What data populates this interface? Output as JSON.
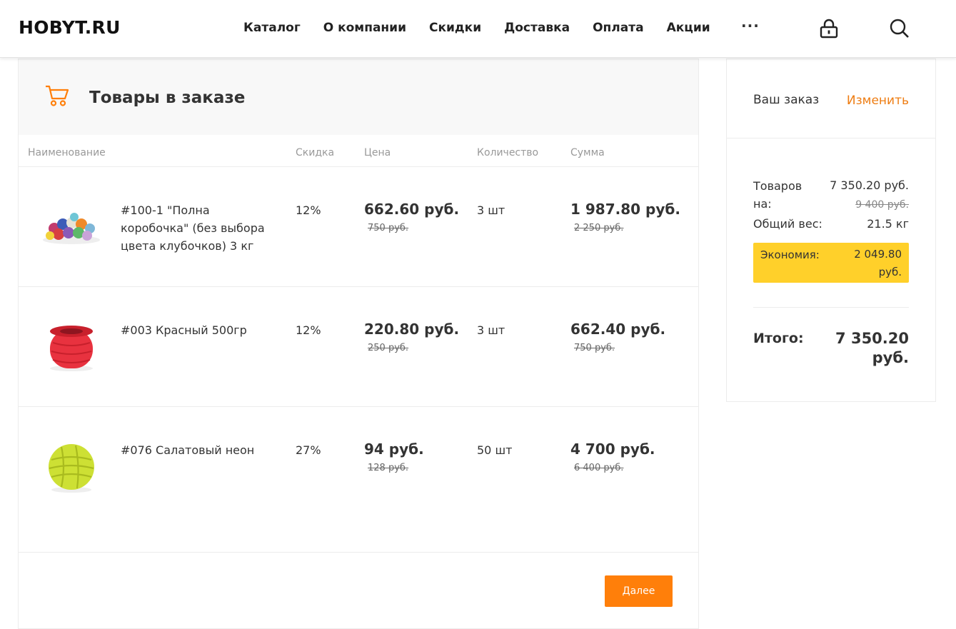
{
  "header": {
    "logo": "HOBYT.RU",
    "nav": [
      "Каталог",
      "О компании",
      "Скидки",
      "Доставка",
      "Оплата",
      "Акции"
    ],
    "more": "···",
    "lock_icon": "lock-icon",
    "search_icon": "search-icon"
  },
  "order": {
    "title": "Товары в заказе",
    "cart_icon": "cart-icon",
    "columns": {
      "name": "Наименование",
      "discount": "Скидка",
      "price": "Цена",
      "quantity": "Количество",
      "sum": "Сумма"
    },
    "items": [
      {
        "name": "#100-1 \"Полна коробочка\" (без выбора цвета клубочков) 3 кг",
        "discount": "12%",
        "price": "662.60 руб.",
        "old_price": "750 руб.",
        "quantity": "3 шт",
        "sum": "1 987.80 руб.",
        "old_sum": "2 250 руб.",
        "thumb": "multicolor-yarn-balls"
      },
      {
        "name": "#003 Красный 500гр",
        "discount": "12%",
        "price": "220.80 руб.",
        "old_price": "250 руб.",
        "quantity": "3 шт",
        "sum": "662.40 руб.",
        "old_sum": "750 руб.",
        "thumb": "red-yarn-spool",
        "thumb_color": "#e8323f"
      },
      {
        "name": "#076 Салатовый неон",
        "discount": "27%",
        "price": "94 руб.",
        "old_price": "128 руб.",
        "quantity": "50 шт",
        "sum": "4 700 руб.",
        "old_sum": "6 400 руб.",
        "thumb": "lime-yarn-ball",
        "thumb_color": "#cde034"
      }
    ],
    "next_label": "Далее"
  },
  "summary": {
    "title": "Ваш заказ",
    "edit_label": "Изменить",
    "goods_label": "Товаров на:",
    "goods_value": "7 350.20 руб.",
    "goods_old": "9 400 руб.",
    "weight_label": "Общий вес:",
    "weight_value": "21.5 кг",
    "economy_label": "Экономия:",
    "economy_value": "2 049.80 руб.",
    "total_label": "Итого:",
    "total_value": "7 350.20 руб."
  },
  "colors": {
    "accent": "#ff7f0a",
    "link": "#ee7d13",
    "highlight": "#ffd02a"
  }
}
